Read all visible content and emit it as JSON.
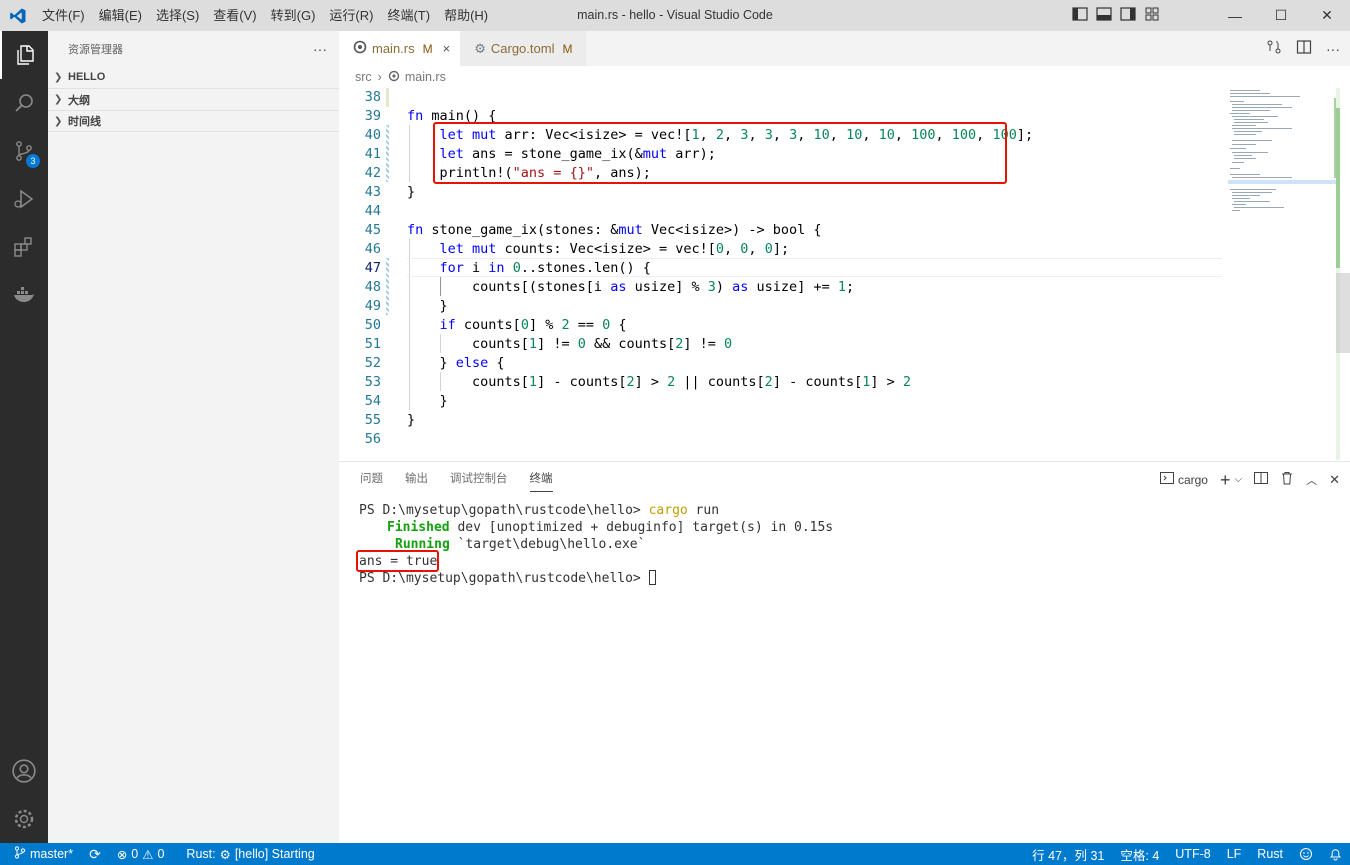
{
  "window": {
    "title": "main.rs - hello - Visual Studio Code",
    "menu": [
      "文件(F)",
      "编辑(E)",
      "选择(S)",
      "查看(V)",
      "转到(G)",
      "运行(R)",
      "终端(T)",
      "帮助(H)"
    ]
  },
  "activity": {
    "scm_badge": "3"
  },
  "sidebar": {
    "title": "资源管理器",
    "more": "···",
    "sections": [
      "HELLO",
      "大纲",
      "时间线"
    ]
  },
  "tabs": [
    {
      "name": "main.rs",
      "status": "M",
      "close": "×"
    },
    {
      "name": "Cargo.toml",
      "status": "M"
    }
  ],
  "breadcrumb": {
    "folder": "src",
    "sep": "›",
    "file": "main.rs"
  },
  "editor": {
    "current_line": 47,
    "lines": [
      {
        "n": "38",
        "html": ""
      },
      {
        "n": "39",
        "html": "<span class='kw'>fn</span> main() {"
      },
      {
        "n": "40",
        "html": "    <span class='kw'>let mut</span> arr: Vec&lt;isize&gt; = vec![<span class='num'>1</span>, <span class='num'>2</span>, <span class='num'>3</span>, <span class='num'>3</span>, <span class='num'>3</span>, <span class='num'>10</span>, <span class='num'>10</span>, <span class='num'>10</span>, <span class='num'>100</span>, <span class='num'>100</span>, <span class='num'>100</span>];"
      },
      {
        "n": "41",
        "html": "    <span class='kw'>let</span> ans = stone_game_ix(&amp;<span class='kw'>mut</span> arr);"
      },
      {
        "n": "42",
        "html": "    println!(<span class='str'>\"ans = {}\"</span>, ans);"
      },
      {
        "n": "43",
        "html": "}"
      },
      {
        "n": "44",
        "html": ""
      },
      {
        "n": "45",
        "html": "<span class='kw'>fn</span> stone_game_ix(stones: &amp;<span class='kw'>mut</span> Vec&lt;isize&gt;) -&gt; bool {"
      },
      {
        "n": "46",
        "html": "    <span class='kw'>let mut</span> counts: Vec&lt;isize&gt; = vec![<span class='num'>0</span>, <span class='num'>0</span>, <span class='num'>0</span>];"
      },
      {
        "n": "47",
        "html": "    <span class='kw'>for</span> i <span class='kw'>in</span> <span class='num'>0</span>..stones.len() {"
      },
      {
        "n": "48",
        "html": "        counts[(stones[i <span class='kw'>as</span> usize] % <span class='num'>3</span>) <span class='kw'>as</span> usize] += <span class='num'>1</span>;"
      },
      {
        "n": "49",
        "html": "    }"
      },
      {
        "n": "50",
        "html": "    <span class='kw'>if</span> counts[<span class='num'>0</span>] % <span class='num'>2</span> == <span class='num'>0</span> {"
      },
      {
        "n": "51",
        "html": "        counts[<span class='num'>1</span>] != <span class='num'>0</span> &amp;&amp; counts[<span class='num'>2</span>] != <span class='num'>0</span>"
      },
      {
        "n": "52",
        "html": "    } <span class='kw'>else</span> {"
      },
      {
        "n": "53",
        "html": "        counts[<span class='num'>1</span>] - counts[<span class='num'>2</span>] &gt; <span class='num'>2</span> || counts[<span class='num'>2</span>] - counts[<span class='num'>1</span>] &gt; <span class='num'>2</span>"
      },
      {
        "n": "54",
        "html": "    }"
      },
      {
        "n": "55",
        "html": "}"
      },
      {
        "n": "56",
        "html": ""
      }
    ]
  },
  "panel": {
    "tabs": [
      "问题",
      "输出",
      "调试控制台",
      "终端"
    ],
    "active_tab": "终端",
    "terminal_name": "cargo",
    "terminal": {
      "l1_prompt": "PS D:\\mysetup\\gopath\\rustcode\\hello> ",
      "l1_cmd": "cargo",
      "l1_arg": " run",
      "l2_status": "Finished",
      "l2_rest": " dev [unoptimized + debuginfo] target(s) in 0.15s",
      "l3_status": "Running",
      "l3_rest": " `target\\debug\\hello.exe`",
      "l4": "ans = true",
      "l5_prompt": "PS D:\\mysetup\\gopath\\rustcode\\hello> "
    }
  },
  "status": {
    "branch": "master*",
    "errors": "0",
    "warnings": "0",
    "rust": "Rust: ",
    "rust_task": "[hello] Starting",
    "position": "行 47，列 31",
    "spaces": "空格: 4",
    "encoding": "UTF-8",
    "eol": "LF",
    "language": "Rust"
  },
  "colors": {
    "accent": "#007acc",
    "highlight_box": "#e51400"
  }
}
